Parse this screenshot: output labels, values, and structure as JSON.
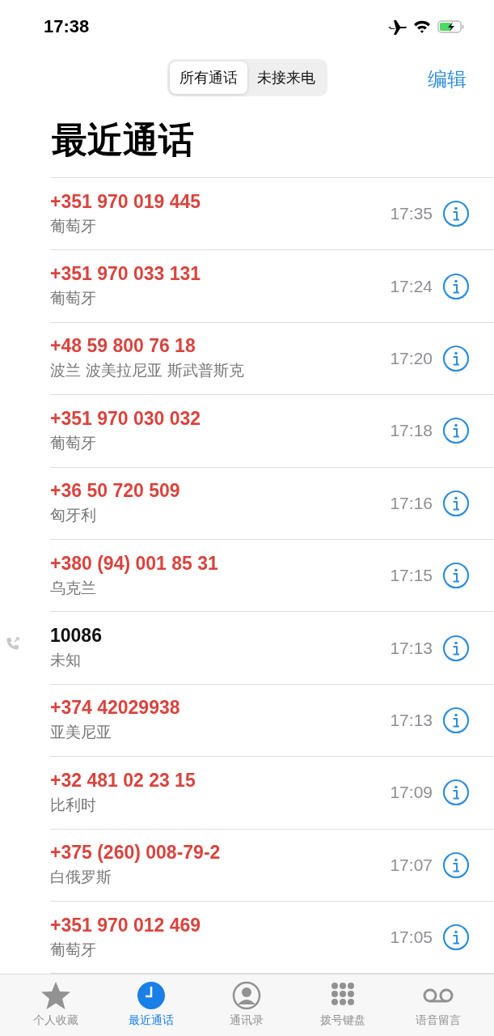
{
  "status_bar": {
    "time": "17:38"
  },
  "segments": [
    {
      "label": "所有通话",
      "selected": true
    },
    {
      "label": "未接来电",
      "selected": false
    }
  ],
  "edit_button": "编辑",
  "title": "最近通话",
  "calls": [
    {
      "number": "+351 970 019 445",
      "location": "葡萄牙",
      "time": "17:35",
      "missed": true,
      "outgoing": false
    },
    {
      "number": "+351 970 033 131",
      "location": "葡萄牙",
      "time": "17:24",
      "missed": true,
      "outgoing": false
    },
    {
      "number": "+48 59 800 76 18",
      "location": "波兰 波美拉尼亚 斯武普斯克",
      "time": "17:20",
      "missed": true,
      "outgoing": false
    },
    {
      "number": "+351 970 030 032",
      "location": "葡萄牙",
      "time": "17:18",
      "missed": true,
      "outgoing": false
    },
    {
      "number": "+36 50 720 509",
      "location": "匈牙利",
      "time": "17:16",
      "missed": true,
      "outgoing": false
    },
    {
      "number": "+380 (94) 001 85 31",
      "location": "乌克兰",
      "time": "17:15",
      "missed": true,
      "outgoing": false
    },
    {
      "number": "10086",
      "location": "未知",
      "time": "17:13",
      "missed": false,
      "outgoing": true
    },
    {
      "number": "+374 42029938",
      "location": "亚美尼亚",
      "time": "17:13",
      "missed": true,
      "outgoing": false
    },
    {
      "number": "+32 481 02 23 15",
      "location": "比利时",
      "time": "17:09",
      "missed": true,
      "outgoing": false
    },
    {
      "number": "+375 (260) 008-79-2",
      "location": "白俄罗斯",
      "time": "17:07",
      "missed": true,
      "outgoing": false
    },
    {
      "number": "+351 970 012 469",
      "location": "葡萄牙",
      "time": "17:05",
      "missed": true,
      "outgoing": false
    }
  ],
  "tab_bar": [
    {
      "label": "个人收藏",
      "kind": "star",
      "selected": false
    },
    {
      "label": "最近通话",
      "kind": "clock",
      "selected": true
    },
    {
      "label": "通讯录",
      "kind": "person",
      "selected": false
    },
    {
      "label": "拨号键盘",
      "kind": "keypad",
      "selected": false
    },
    {
      "label": "语音留言",
      "kind": "voicemail",
      "selected": false
    }
  ]
}
